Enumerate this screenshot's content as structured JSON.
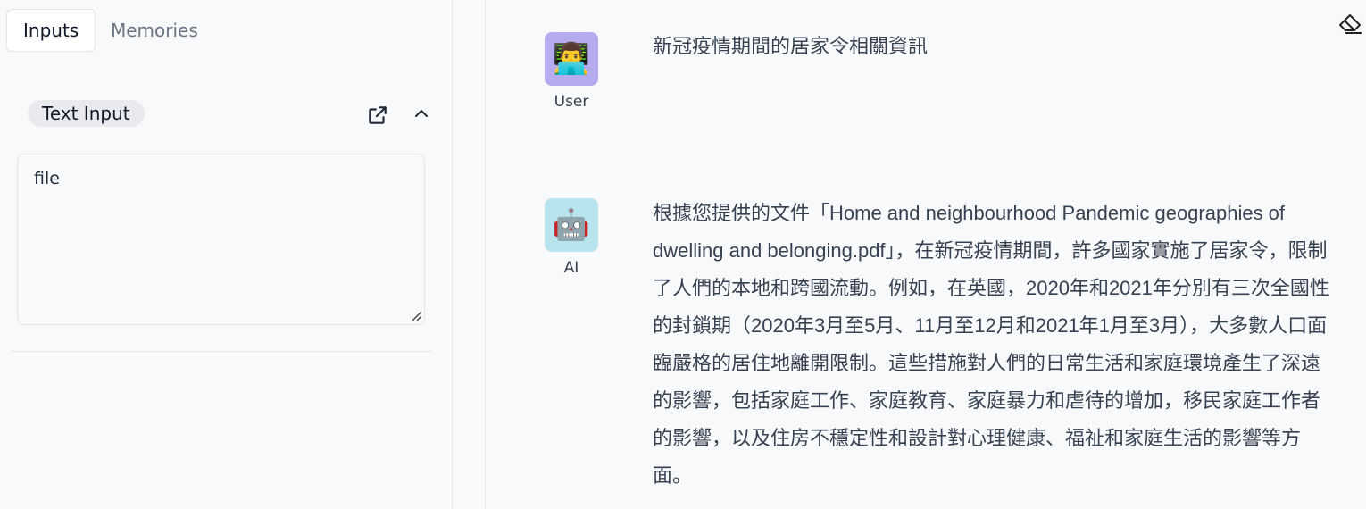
{
  "tabs": [
    {
      "label": "Inputs",
      "active": true
    },
    {
      "label": "Memories",
      "active": false
    }
  ],
  "input_section": {
    "badge_label": "Text Input",
    "text_value": "file"
  },
  "chat": {
    "messages": [
      {
        "role_label": "User",
        "avatar": "👨‍💻",
        "text": "新冠疫情期間的居家令相關資訊"
      },
      {
        "role_label": "AI",
        "avatar": "🤖",
        "text": "根據您提供的文件「Home and neighbourhood Pandemic geographies of dwelling and belonging.pdf」，在新冠疫情期間，許多國家實施了居家令，限制了人們的本地和跨國流動。例如，在英國，2020年和2021年分別有三次全國性的封鎖期（2020年3月至5月、11月至12月和2021年1月至3月），大多數人口面臨嚴格的居住地離開限制。這些措施對人們的日常生活和家庭環境產生了深遠的影響，包括家庭工作、家庭教育、家庭暴力和虐待的增加，移民家庭工作者的影響，以及住房不穩定性和設計對心理健康、福祉和家庭生活的影響等方面。"
      }
    ]
  },
  "icons": {
    "external_link": "external-link-icon",
    "collapse": "chevron-up-icon",
    "clear": "eraser-icon"
  },
  "colors": {
    "user_avatar_bg": "#b4acef",
    "ai_avatar_bg": "#b8e4ee"
  }
}
